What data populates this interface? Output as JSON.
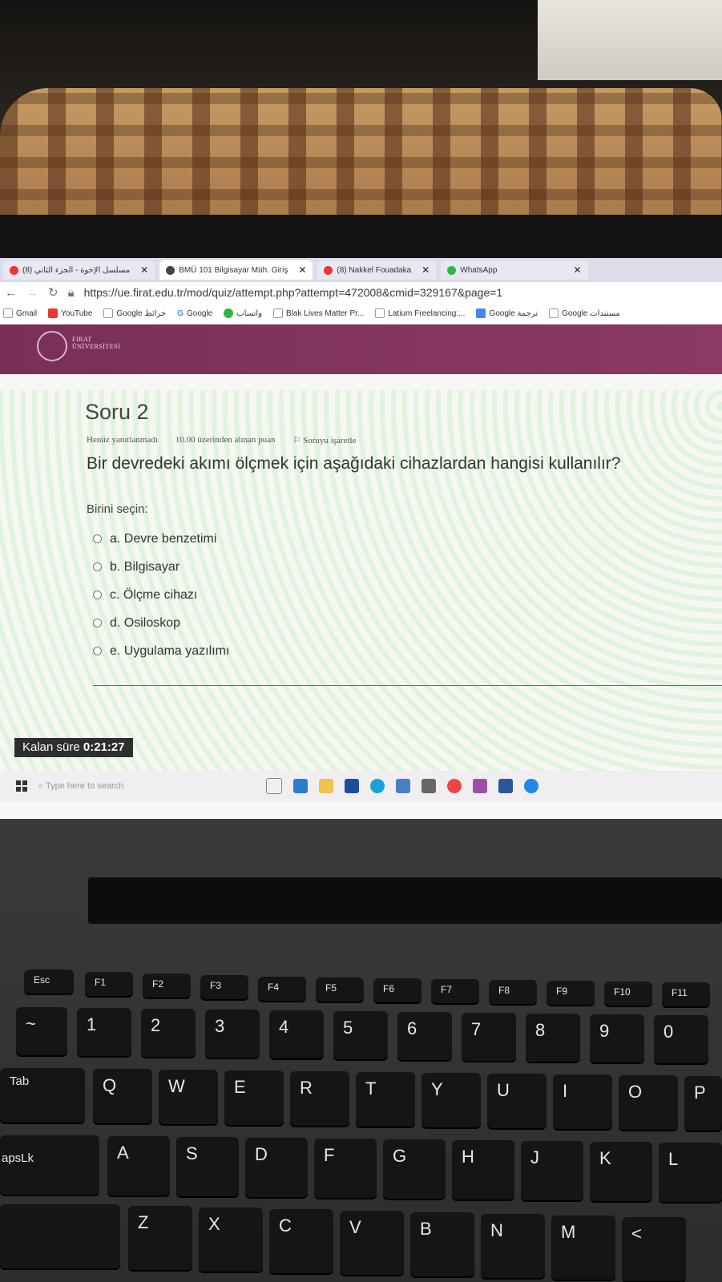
{
  "browser": {
    "tabs": [
      {
        "label": "مسلسل الإخوة - الجزء الثاني (8)",
        "active": false
      },
      {
        "label": "BMÜ 101 Bilgisayar Müh. Giriş",
        "active": true
      },
      {
        "label": "(8) Nakkel Fouadaka",
        "active": false
      },
      {
        "label": "WhatsApp",
        "active": false
      }
    ],
    "url": "https://ue.firat.edu.tr/mod/quiz/attempt.php?attempt=472008&cmid=329167&page=1",
    "bookmarks": [
      "Gmail",
      "YouTube",
      "Google خرائط",
      "Google",
      "واتساب",
      "Blak Lives Matter Pr...",
      "Latium Freelancing:...",
      "Google ترجمة",
      "Google مستندات"
    ]
  },
  "site": {
    "logo_line1": "FIRAT",
    "logo_line2": "ÜNİVERSİTESİ"
  },
  "quiz": {
    "title": "Soru 2",
    "status": "Henüz yanıtlanmadı",
    "points": "10.00 üzerinden alınan puan",
    "flag": "Soruyu işaretle",
    "question": "Bir devredeki akımı ölçmek için aşağıdaki cihazlardan hangisi kullanılır?",
    "prompt": "Birini seçin:",
    "options": [
      "a. Devre benzetimi",
      "b. Bilgisayar",
      "c. Ölçme cihazı",
      "d. Osiloskop",
      "e. Uygulama yazılımı"
    ],
    "timer_label": "Kalan süre",
    "timer_value": "0:21:27"
  },
  "taskbar": {
    "search_placeholder": "Type here to search"
  },
  "keyboard": {
    "row_f": [
      "Esc",
      "F1",
      "F2",
      "F3",
      "F4",
      "F5",
      "F6",
      "F7",
      "F8",
      "F9",
      "F10",
      "F11"
    ],
    "row_num": [
      "~",
      "1",
      "2",
      "3",
      "4",
      "5",
      "6",
      "7",
      "8",
      "9",
      "0"
    ],
    "row_q": [
      "Tab",
      "Q",
      "W",
      "E",
      "R",
      "T",
      "Y",
      "U",
      "I",
      "O",
      "P"
    ],
    "row_a": [
      "apsLk",
      "A",
      "S",
      "D",
      "F",
      "G",
      "H",
      "J",
      "K",
      "L"
    ],
    "row_z": [
      "Z",
      "X",
      "C",
      "V",
      "B",
      "N",
      "M",
      "<"
    ]
  }
}
